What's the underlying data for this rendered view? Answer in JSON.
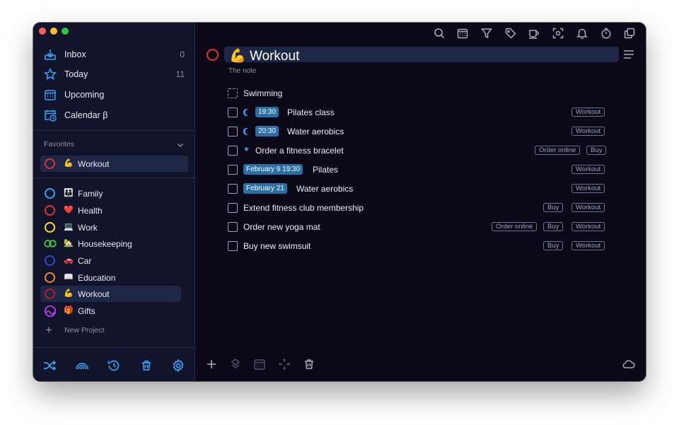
{
  "sidebar": {
    "nav": [
      {
        "label": "Inbox",
        "count": "0",
        "icon": "inbox-icon"
      },
      {
        "label": "Today",
        "count": "11",
        "icon": "star-icon"
      },
      {
        "label": "Upcoming",
        "count": "",
        "icon": "calendar-grid-icon"
      },
      {
        "label": "Calendar β",
        "count": "",
        "icon": "calendar-clock-icon"
      }
    ],
    "favorites_label": "Favorites",
    "favorite": {
      "label": "Workout",
      "emoji": "💪",
      "ring": "#e0302f"
    },
    "projects": [
      {
        "label": "Family",
        "emoji": "👪",
        "ring": "#3aa0f5"
      },
      {
        "label": "Health",
        "emoji": "❤️",
        "ring": "#e0302f"
      },
      {
        "label": "Work",
        "emoji": "💻",
        "ring": "#f5e31b"
      },
      {
        "label": "Housekeeping",
        "emoji": "🏡",
        "ring": "#3ecf3e"
      },
      {
        "label": "Car",
        "emoji": "🚗",
        "ring": "#2b4ad8"
      },
      {
        "label": "Education",
        "emoji": "📖",
        "ring": "#f08c2e"
      },
      {
        "label": "Workout",
        "emoji": "💪",
        "ring": "#b81d2c"
      },
      {
        "label": "Gifts",
        "emoji": "🎁",
        "ring": "#b43ee6"
      }
    ],
    "new_project": "New Project",
    "bottom_icons": [
      "shuffle-icon",
      "rainbow-icon",
      "history-icon",
      "trash-icon",
      "settings-icon"
    ]
  },
  "main": {
    "toolbar_icons": [
      "search-icon",
      "calendar-icon",
      "filter-icon",
      "tag-icon",
      "coffee-icon",
      "focus-icon",
      "bell-icon",
      "timer-icon",
      "copy-icon"
    ],
    "title": "Workout",
    "title_emoji": "💪",
    "note": "The note",
    "tasks": [
      {
        "title": "Swimming",
        "dashed": true,
        "time": "",
        "marker": "",
        "tags": []
      },
      {
        "title": "Pilates class",
        "time": "19:30",
        "marker": "moon",
        "tags": [
          "Workout"
        ]
      },
      {
        "title": "Water aerobics",
        "time": "20:30",
        "marker": "moon",
        "tags": [
          "Workout"
        ]
      },
      {
        "title": "Order a fitness bracelet",
        "time": "",
        "marker": "star",
        "tags": [
          "Order online",
          "Buy"
        ]
      },
      {
        "title": "Pilates",
        "time": "February 9 19:30",
        "marker": "",
        "tags": [
          "Workout"
        ]
      },
      {
        "title": "Water aerobics",
        "time": "February 21",
        "marker": "",
        "tags": [
          "Workout"
        ]
      },
      {
        "title": "Extend fitness club membership",
        "time": "",
        "marker": "",
        "tags": [
          "Buy",
          "Workout"
        ]
      },
      {
        "title": "Order new yoga mat",
        "time": "",
        "marker": "",
        "tags": [
          "Order online",
          "Buy",
          "Workout"
        ]
      },
      {
        "title": "Buy new swimsuit",
        "time": "",
        "marker": "",
        "tags": [
          "Buy",
          "Workout"
        ]
      }
    ],
    "footer_icons": [
      "add-icon",
      "layers-icon",
      "calendar-icon",
      "move-icon",
      "trash-icon",
      "cloud-icon"
    ]
  },
  "colors": {
    "accent": "#3aa0f5",
    "selection": "#1e2745",
    "badge": "#2a6fa6"
  }
}
